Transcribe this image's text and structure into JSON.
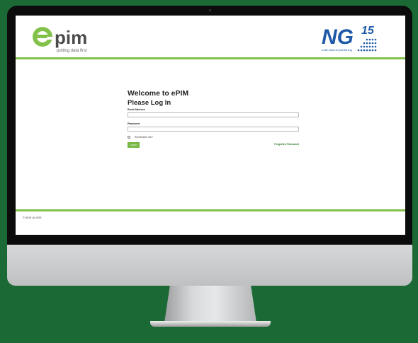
{
  "colors": {
    "accent_green": "#83c24a",
    "button_green": "#76b843",
    "link_green": "#2f7a2c",
    "ng_blue": "#1e5aa8",
    "background": "#1b6a35"
  },
  "header": {
    "epim_logo": {
      "wordmark": "pim",
      "tagline": "putting data first"
    },
    "ng_logo": {
      "wordmark": "NG",
      "superscript": "15",
      "tagline": "multi-channel publishing"
    }
  },
  "login": {
    "welcome": "Welcome to ePIM",
    "subtitle": "Please Log In",
    "email_label": "Email Address",
    "email_value": "",
    "password_label": "Password",
    "password_value": "",
    "remember_label": "Remember me?",
    "login_button": "Log In",
    "forgot_link": "Forgotten Password"
  },
  "footer": {
    "copyright": "© NG15 Ltd 2019"
  }
}
